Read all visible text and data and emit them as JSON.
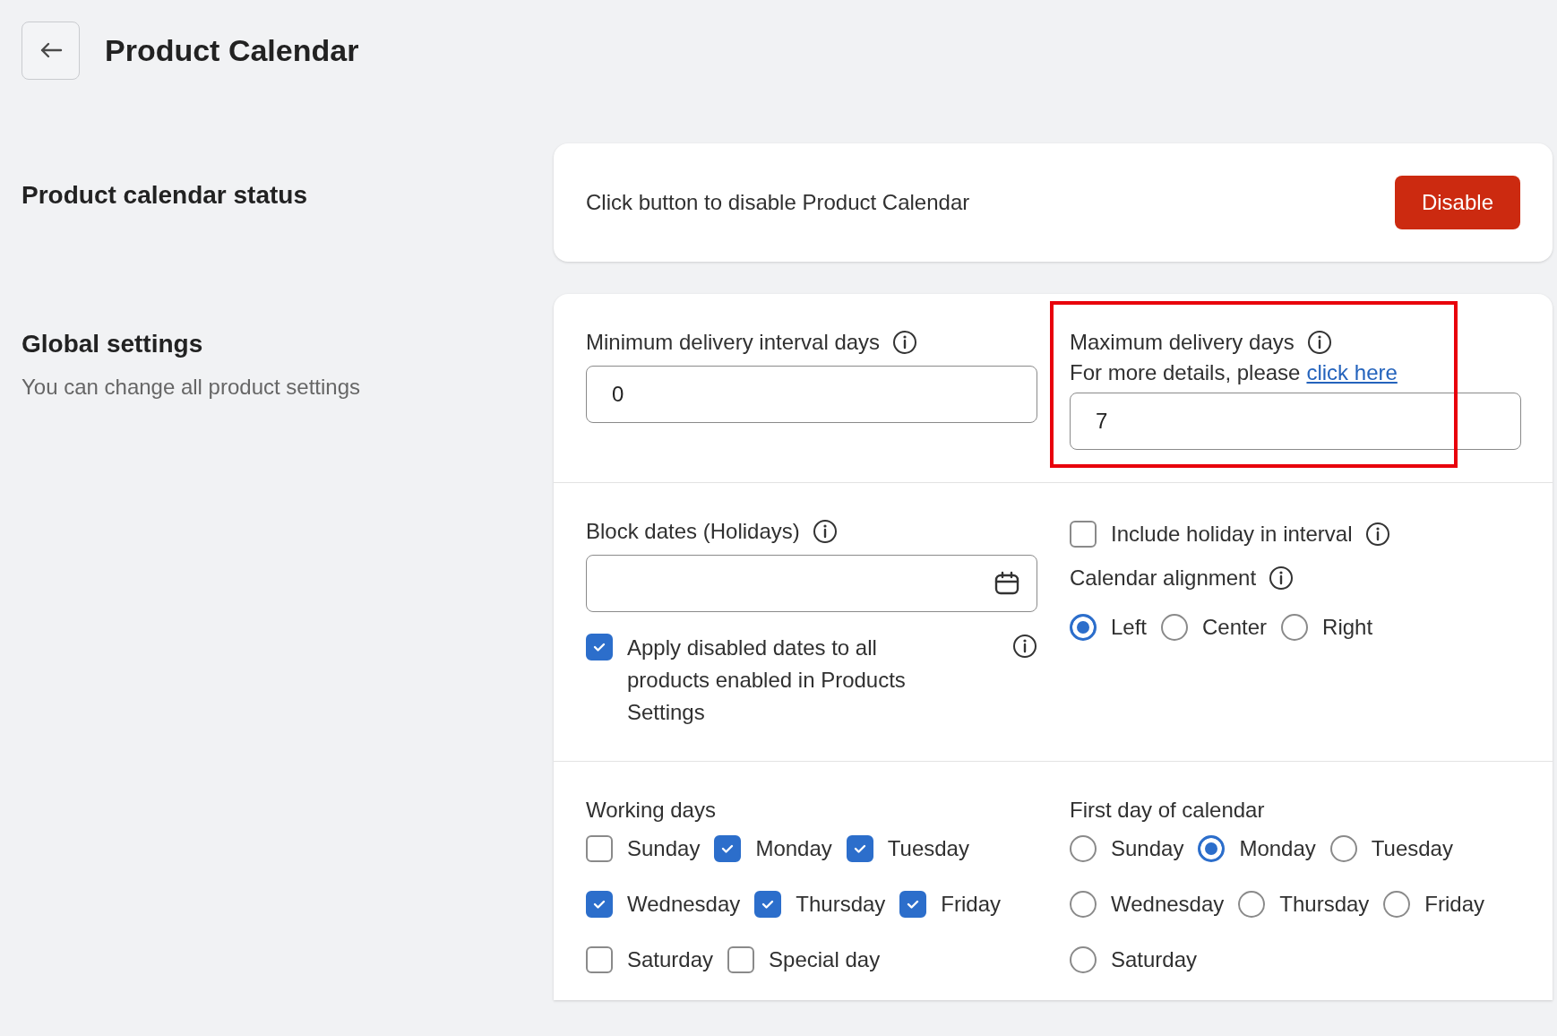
{
  "header": {
    "title": "Product Calendar"
  },
  "sections": [
    {
      "title": "Product calendar status"
    },
    {
      "title": "Global settings",
      "description": "You can change all product settings"
    }
  ],
  "status_card": {
    "text": "Click button to disable Product Calendar",
    "button": "Disable"
  },
  "min_interval": {
    "label": "Minimum delivery interval days",
    "value": "0"
  },
  "max_days": {
    "label": "Maximum delivery days",
    "hint": "For more details, please",
    "link": "click here",
    "value": "7",
    "highlighted": true
  },
  "block_dates": {
    "label": "Block dates (Holidays)",
    "apply": {
      "label": "Apply disabled dates to all products enabled in Products Settings",
      "checked": true
    }
  },
  "include_holiday": {
    "label": "Include holiday in interval",
    "checked": false
  },
  "alignment": {
    "label": "Calendar alignment",
    "options": [
      {
        "label": "Left",
        "selected": true
      },
      {
        "label": "Center",
        "selected": false
      },
      {
        "label": "Right",
        "selected": false
      }
    ]
  },
  "working_days": {
    "label": "Working days",
    "days": [
      {
        "label": "Sunday",
        "checked": false
      },
      {
        "label": "Monday",
        "checked": true
      },
      {
        "label": "Tuesday",
        "checked": true
      },
      {
        "label": "Wednesday",
        "checked": true
      },
      {
        "label": "Thursday",
        "checked": true
      },
      {
        "label": "Friday",
        "checked": true
      },
      {
        "label": "Saturday",
        "checked": false
      },
      {
        "label": "Special day",
        "checked": false
      }
    ]
  },
  "first_day": {
    "label": "First day of calendar",
    "options": [
      {
        "label": "Sunday",
        "selected": false
      },
      {
        "label": "Monday",
        "selected": true
      },
      {
        "label": "Tuesday",
        "selected": false
      },
      {
        "label": "Wednesday",
        "selected": false
      },
      {
        "label": "Thursday",
        "selected": false
      },
      {
        "label": "Friday",
        "selected": false
      },
      {
        "label": "Saturday",
        "selected": false
      }
    ]
  }
}
